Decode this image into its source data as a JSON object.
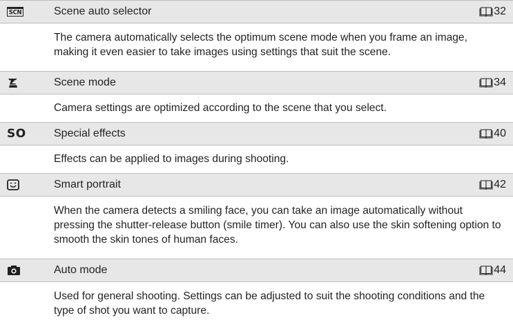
{
  "modes": [
    {
      "icon": "scene-auto-selector-icon",
      "name": "Scene auto selector",
      "page": "32",
      "description": "The camera automatically selects the optimum scene mode when you frame an image, making it even easier to take images using settings that suit the scene."
    },
    {
      "icon": "scene-mode-icon",
      "name": "Scene mode",
      "page": "34",
      "description": "Camera settings are optimized according to the scene that you select."
    },
    {
      "icon": "special-effects-icon",
      "icon_text": "SO",
      "name": "Special effects",
      "page": "40",
      "description": "Effects can be applied to images during shooting."
    },
    {
      "icon": "smart-portrait-icon",
      "name": "Smart portrait",
      "page": "42",
      "description": "When the camera detects a smiling face, you can take an image automatically without pressing the shutter-release button (smile timer). You can also use the skin softening option to smooth the skin tones of human faces."
    },
    {
      "icon": "auto-mode-icon",
      "name": "Auto mode",
      "page": "44",
      "description": "Used for general shooting. Settings can be adjusted to suit the shooting conditions and the type of shot you want to capture."
    }
  ],
  "page_ref_icon": "book-reference-icon",
  "colors": {
    "header_background": "#e7e7e7",
    "header_border": "#bcbcbc",
    "text": "#231f20"
  }
}
